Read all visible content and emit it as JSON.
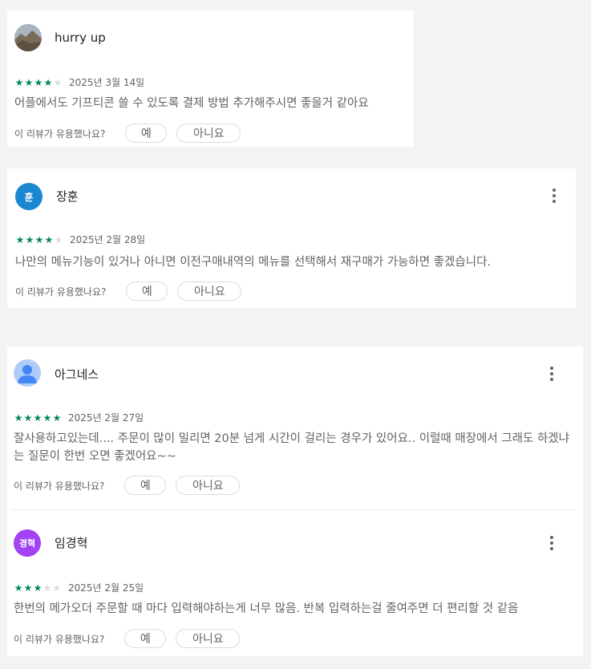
{
  "helpful_prompt": "이 리뷰가 유용했나요?",
  "yes_label": "예",
  "no_label": "아니요",
  "colors": {
    "star_on": "#01875f",
    "star_off": "#dadce0",
    "avatar_hun": "#1a88d0",
    "avatar_agnes": "#aecbfa",
    "avatar_gh": "#a142f4"
  },
  "reviews": [
    {
      "author": "hurry up",
      "avatar_text": "",
      "rating": 4,
      "date": "2025년 3월 14일",
      "text": "어플에서도 기프티콘 쓸 수 있도록 결제 방법 추가해주시면 좋을거 같아요"
    },
    {
      "author": "장훈",
      "avatar_text": "훈",
      "rating": 4,
      "date": "2025년 2월 28일",
      "text": "나만의 메뉴기능이 있거나 아니면 이전구매내역의 메뉴를 선택해서 재구매가 가능하면 좋겠습니다."
    },
    {
      "author": "아그네스",
      "avatar_text": "",
      "rating": 5,
      "date": "2025년 2월 27일",
      "text": "잘사용하고있는데.... 주문이 많이 밀리면 20분 넘게 시간이 걸리는 경우가 있어요.. 이럴때 매장에서 그래도 하겠냐는 질문이 한번 오면 좋겠어요~~"
    },
    {
      "author": "임경혁",
      "avatar_text": "경혁",
      "rating": 3,
      "date": "2025년 2월 25일",
      "text": "한번의 메가오더 주문할 때 마다 입력해야하는게 너무 많음. 반복 입력하는걸 줄여주면 더 편리할 것 같음"
    }
  ]
}
